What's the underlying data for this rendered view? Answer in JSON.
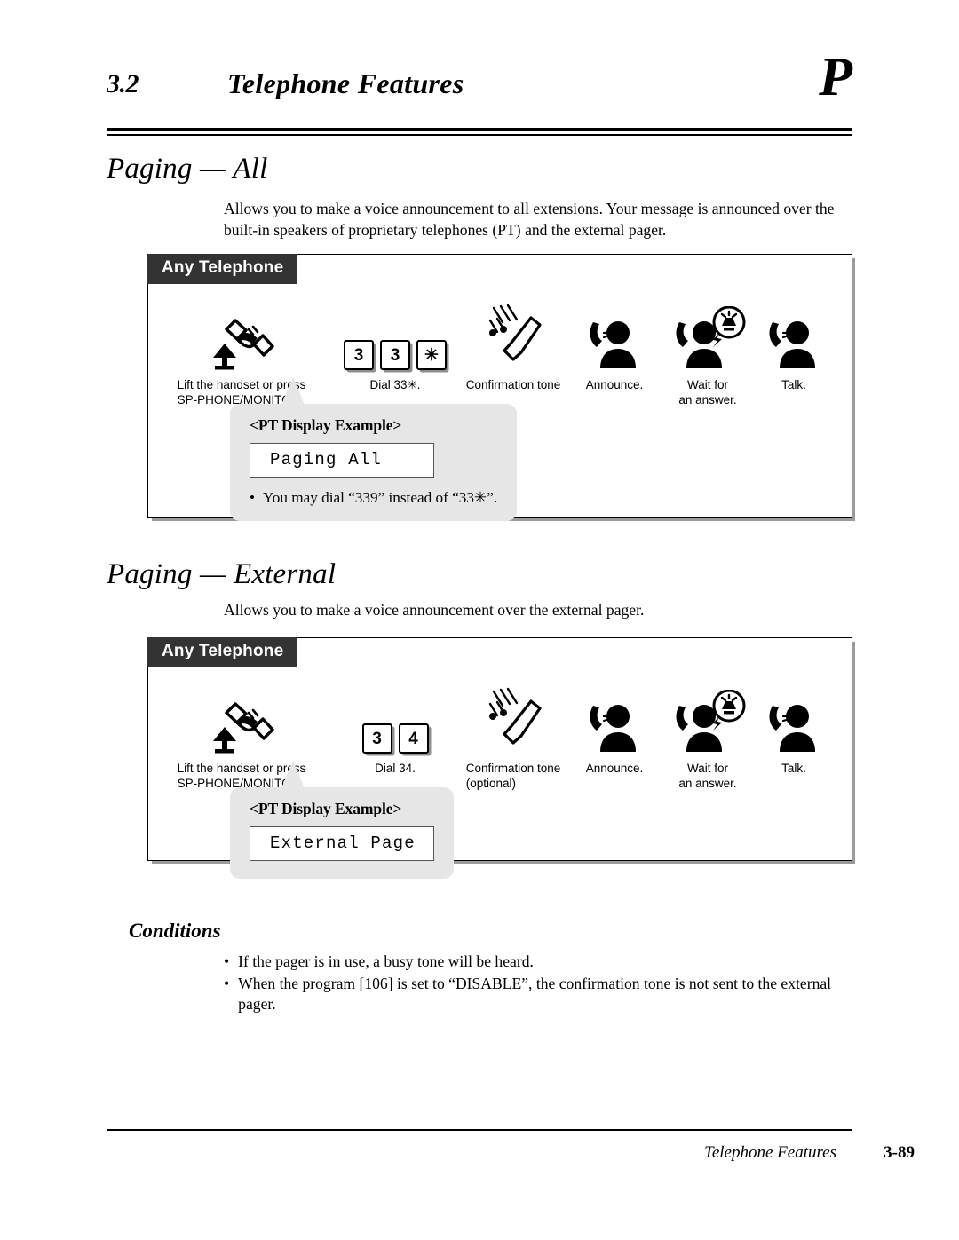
{
  "header": {
    "section_number": "3.2",
    "section_title": "Telephone Features",
    "thumb_tab": "P"
  },
  "features": [
    {
      "title": "Paging — All",
      "description": "Allows you to make a voice announcement to all extensions. Your message is announced over the built-in speakers of proprietary telephones (PT) and the external pager.",
      "diagram": {
        "tag": "Any Telephone",
        "steps": [
          {
            "icon": "lift-handset-icon",
            "label": "Lift the handset or press\nSP-PHONE/MONITOR."
          },
          {
            "icon": "dial-keys-icon",
            "keys": [
              "3",
              "3",
              "✳"
            ],
            "label": "Dial 33✳."
          },
          {
            "icon": "confirmation-tone-icon",
            "label": "Confirmation tone"
          },
          {
            "icon": "person-announce-icon",
            "label": "Announce."
          },
          {
            "icon": "person-wait-answer-icon",
            "label": "Wait for\nan answer."
          },
          {
            "icon": "person-talk-icon",
            "label": "Talk."
          }
        ],
        "callout": {
          "title": "<PT Display Example>",
          "lcd_text": "Paging All",
          "note": "You may dial “339” instead of “33✳”."
        }
      }
    },
    {
      "title": "Paging — External",
      "description": "Allows you to make a voice announcement over the external pager.",
      "diagram": {
        "tag": "Any Telephone",
        "steps": [
          {
            "icon": "lift-handset-icon",
            "label": "Lift the handset or press\nSP-PHONE/MONITOR."
          },
          {
            "icon": "dial-keys-icon",
            "keys": [
              "3",
              "4"
            ],
            "label": "Dial 34."
          },
          {
            "icon": "confirmation-tone-icon",
            "label": "Confirmation tone\n(optional)"
          },
          {
            "icon": "person-announce-icon",
            "label": "Announce."
          },
          {
            "icon": "person-wait-answer-icon",
            "label": "Wait for\nan answer."
          },
          {
            "icon": "person-talk-icon",
            "label": "Talk."
          }
        ],
        "callout": {
          "title": "<PT Display Example>",
          "lcd_text": "External Page"
        }
      }
    }
  ],
  "conditions": {
    "title": "Conditions",
    "items": [
      "If the pager is in use, a busy tone will be heard.",
      "When the program [106] is set to “DISABLE”, the confirmation tone is not sent to the external pager."
    ]
  },
  "footer": {
    "title": "Telephone Features",
    "page_number": "3-89"
  }
}
